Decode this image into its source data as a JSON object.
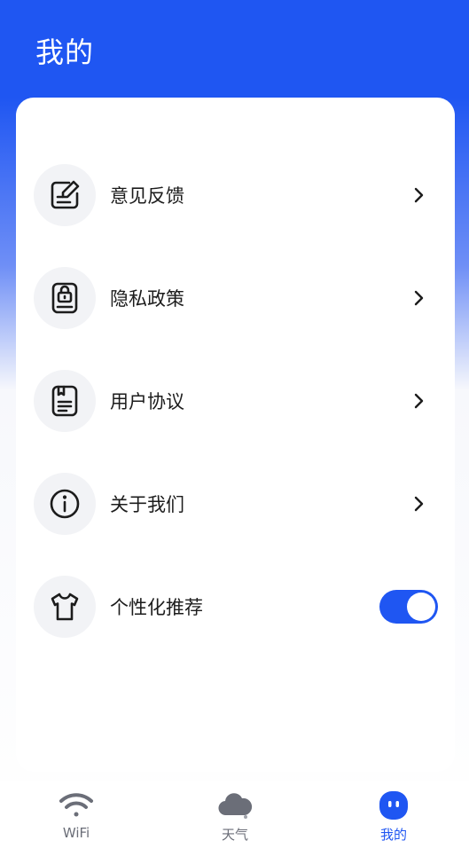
{
  "header": {
    "title": "我的"
  },
  "menu": {
    "items": [
      {
        "label": "意见反馈",
        "icon": "feedback-icon"
      },
      {
        "label": "隐私政策",
        "icon": "privacy-lock-icon"
      },
      {
        "label": "用户协议",
        "icon": "document-icon"
      },
      {
        "label": "关于我们",
        "icon": "info-icon"
      },
      {
        "label": "个性化推荐",
        "icon": "tshirt-icon",
        "toggle": true
      }
    ]
  },
  "tabs": [
    {
      "label": "WiFi",
      "icon": "wifi-icon",
      "active": false
    },
    {
      "label": "天气",
      "icon": "cloud-icon",
      "active": false
    },
    {
      "label": "我的",
      "icon": "profile-face-icon",
      "active": true
    }
  ],
  "colors": {
    "accent": "#1f56f2"
  }
}
